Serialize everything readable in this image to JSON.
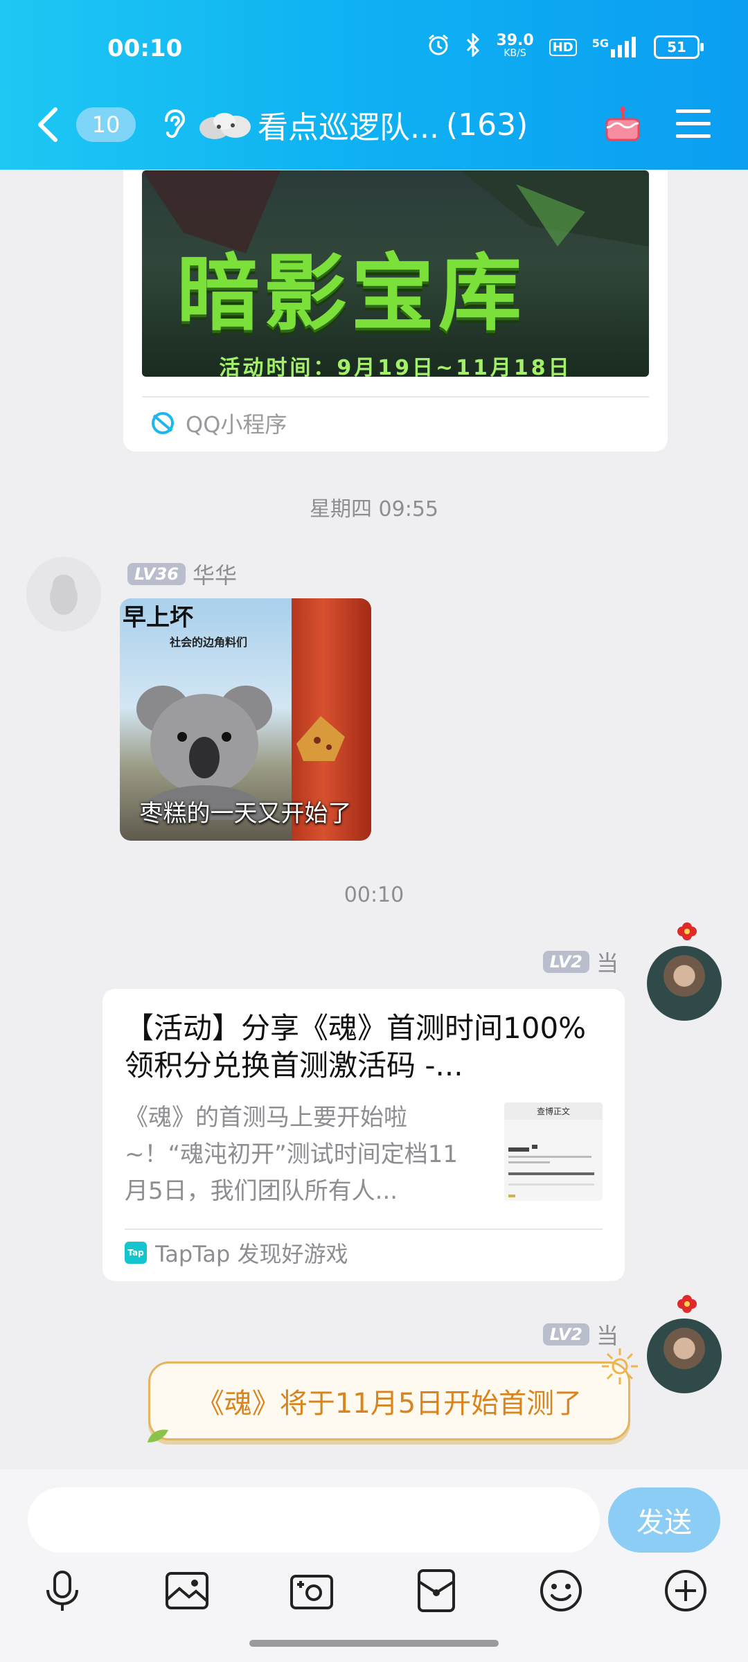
{
  "status_bar": {
    "time": "00:10",
    "network_speed": "39.0",
    "network_unit": "KB/S",
    "hd": "HD",
    "signal": "5G",
    "battery": "51"
  },
  "header": {
    "unread_count": "10",
    "chat_title": "看点巡逻队...",
    "member_count": "(163)"
  },
  "messages": {
    "mini_program": {
      "banner_title": "暗影宝库",
      "banner_subtitle": "活动时间：9月19日~11月18日",
      "label": "QQ小程序"
    },
    "time_1": "星期四 09:55",
    "meme_msg": {
      "level": "LV36",
      "sender": "华华",
      "meme_top": "早上坏",
      "meme_small": "社会的边角料们",
      "meme_bottom": "枣糕的一天又开始了"
    },
    "time_2": "00:10",
    "link_msg": {
      "level": "LV2",
      "sender": "当",
      "title": "【活动】分享《魂》首测时间100%领积分兑换首测激活码 -...",
      "description": "《魂》的首测马上要开始啦~！“魂沌初开”测试时间定档11月5日，我们团队所有人...",
      "thumb_header": "查博正文",
      "source": "TapTap 发现好游戏",
      "source_logo": "Tap"
    },
    "text_msg": {
      "level": "LV2",
      "sender": "当",
      "text": "《魂》将于11月5日开始首测了"
    }
  },
  "input_bar": {
    "placeholder": "",
    "send_label": "发送"
  },
  "colors": {
    "header_start": "#1ec8f3",
    "header_end": "#0b9ef1",
    "send_button": "#8ccdf5",
    "special_text": "#d8851f"
  }
}
